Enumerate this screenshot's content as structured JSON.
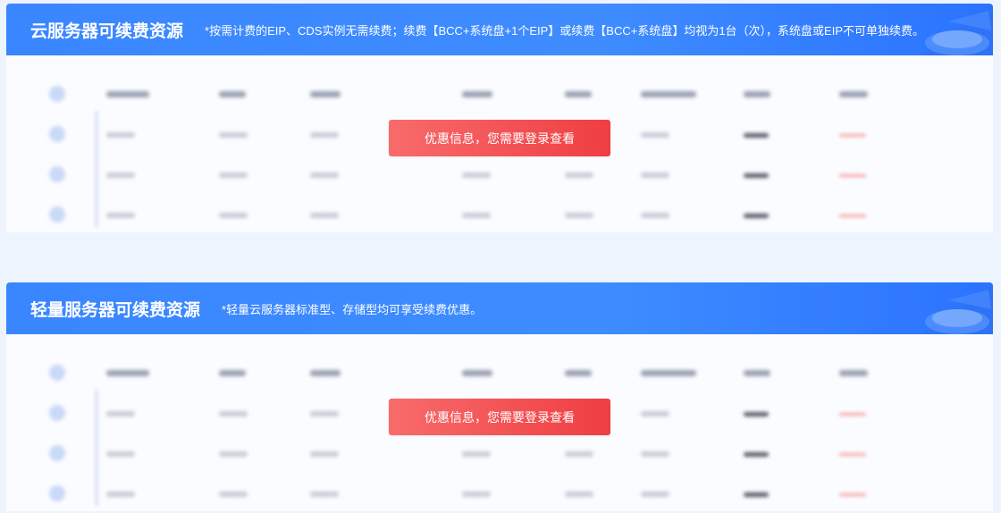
{
  "sections": [
    {
      "title": "云服务器可续费资源",
      "note": "*按需计费的EIP、CDS实例无需续费；续费【BCC+系统盘+1个EIP】或续费【BCC+系统盘】均视为1台（次），系统盘或EIP不可单独续费。",
      "cta_label": "优惠信息，您需要登录查看"
    },
    {
      "title": "轻量服务器可续费资源",
      "note": "*轻量云服务器标准型、存储型均可享受续费优惠。",
      "cta_label": "优惠信息，您需要登录查看"
    }
  ],
  "colors": {
    "header_blue": "#3a86ff",
    "cta_red_start": "#f86b6b",
    "cta_red_end": "#ef3e43",
    "page_bg": "#eef4fd"
  }
}
